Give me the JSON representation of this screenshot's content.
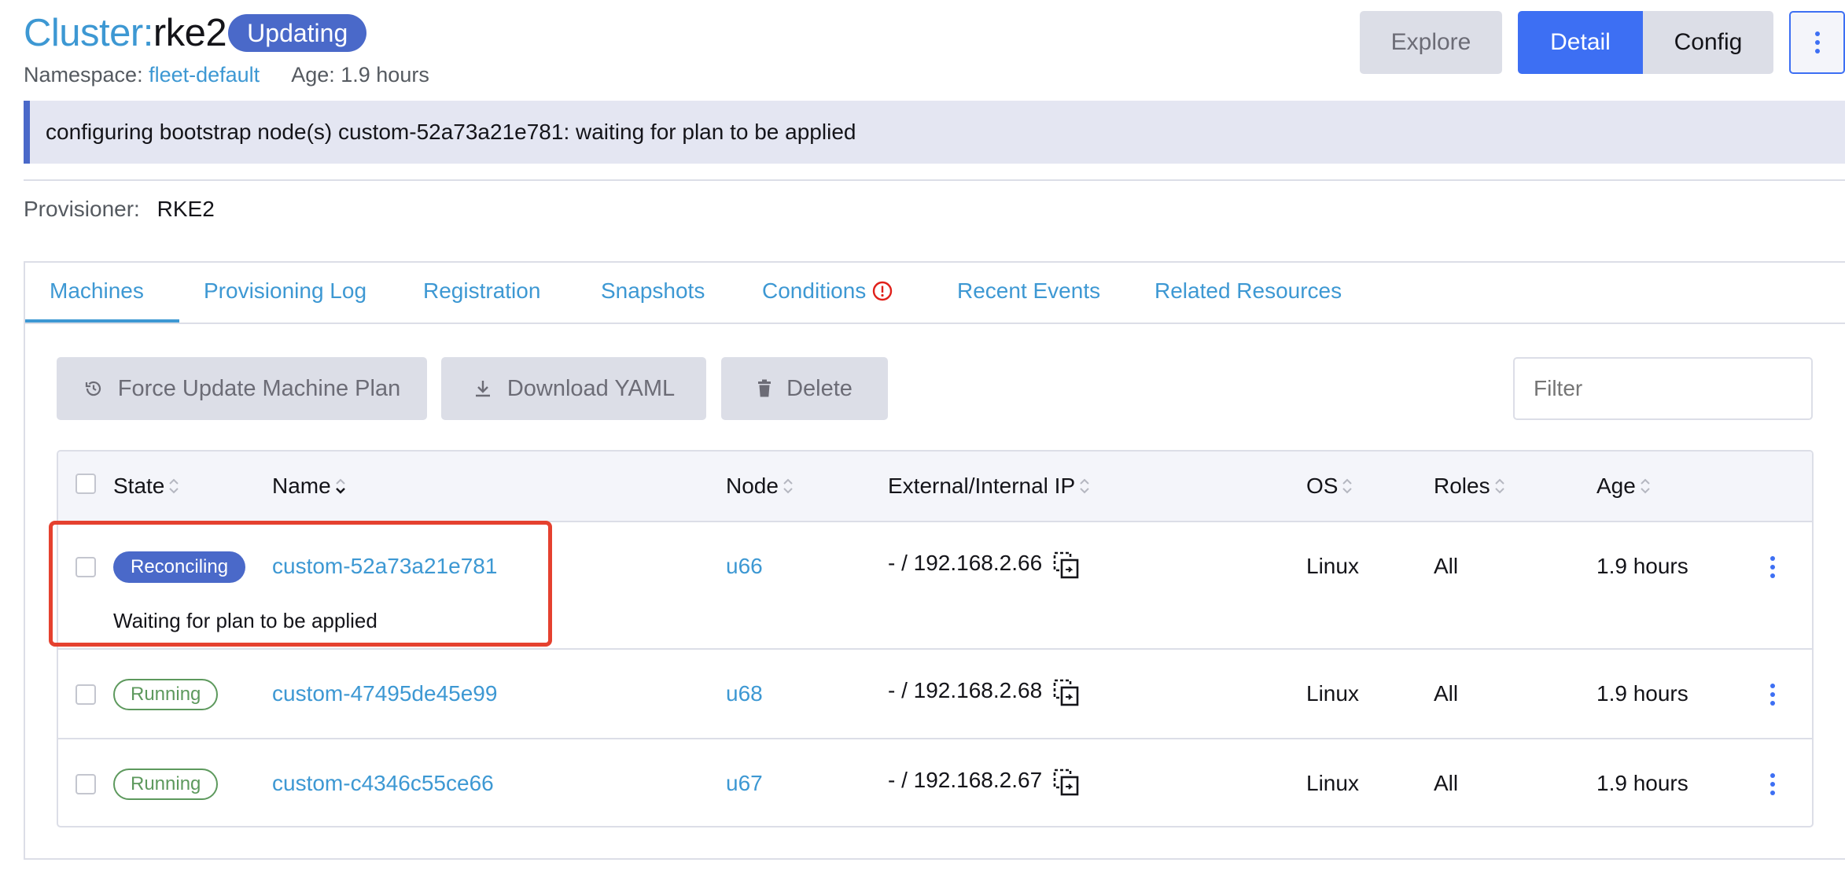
{
  "header": {
    "title_prefix": "Cluster:",
    "title_name": "rke2",
    "state": "Updating",
    "namespace_label": "Namespace:",
    "namespace_value": "fleet-default",
    "age_label": "Age:",
    "age_value": "1.9 hours"
  },
  "actions": {
    "explore": "Explore",
    "detail": "Detail",
    "config": "Config",
    "more_icon": "kebab-vertical-icon"
  },
  "banner": {
    "message": "configuring bootstrap node(s) custom-52a73a21e781: waiting for plan to be applied"
  },
  "provisioner": {
    "label": "Provisioner:",
    "value": "RKE2"
  },
  "tabs": [
    {
      "label": "Machines",
      "active": true
    },
    {
      "label": "Provisioning Log"
    },
    {
      "label": "Registration"
    },
    {
      "label": "Snapshots"
    },
    {
      "label": "Conditions",
      "icon": "warning-circle-icon"
    },
    {
      "label": "Recent Events"
    },
    {
      "label": "Related Resources"
    }
  ],
  "toolbar": {
    "force_update": "Force Update Machine Plan",
    "download_yaml": "Download YAML",
    "delete": "Delete",
    "filter_placeholder": "Filter"
  },
  "table": {
    "columns": [
      "State",
      "Name",
      "Node",
      "External/Internal IP",
      "OS",
      "Roles",
      "Age"
    ],
    "rows": [
      {
        "state": "Reconciling",
        "name": "custom-52a73a21e781",
        "node": "u66",
        "ip": "- / 192.168.2.66",
        "os": "Linux",
        "roles": "All",
        "age": "1.9 hours",
        "message": "Waiting for plan to be applied"
      },
      {
        "state": "Running",
        "name": "custom-47495de45e99",
        "node": "u68",
        "ip": "- / 192.168.2.68",
        "os": "Linux",
        "roles": "All",
        "age": "1.9 hours"
      },
      {
        "state": "Running",
        "name": "custom-c4346c55ce66",
        "node": "u67",
        "ip": "- / 192.168.2.67",
        "os": "Linux",
        "roles": "All",
        "age": "1.9 hours"
      }
    ]
  },
  "colors": {
    "accent": "#3d6ff3",
    "link": "#3d98d3",
    "updating": "#4a69c9",
    "running": "#5d995d",
    "highlight": "#e5412f"
  }
}
